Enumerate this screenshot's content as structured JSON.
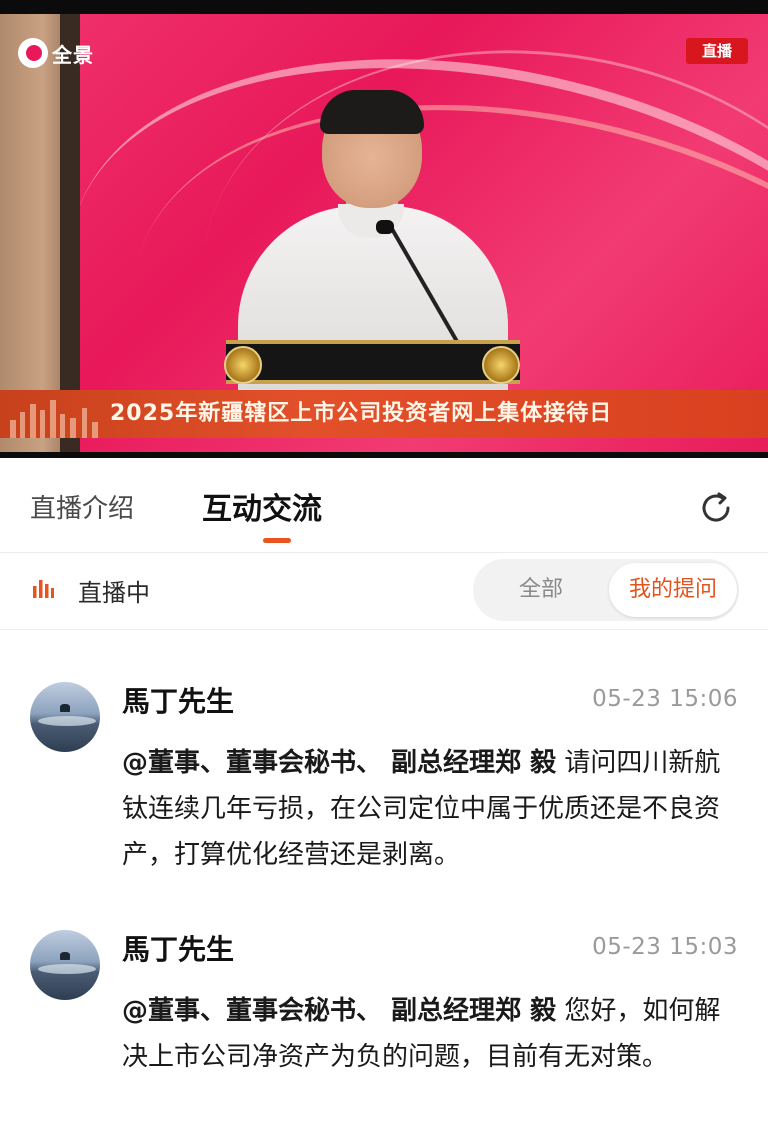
{
  "video": {
    "brand_name": "全景",
    "live_badge": "直播",
    "banner_title": "2025年新疆辖区上市公司投资者网上集体接待日"
  },
  "tabs": {
    "intro_label": "直播介绍",
    "interact_label": "互动交流",
    "active": "互动交流"
  },
  "status": {
    "live_text": "直播中",
    "filter_all": "全部",
    "filter_mine": "我的提问",
    "filter_selected": "我的提问"
  },
  "messages": [
    {
      "author": "馬丁先生",
      "time": "05-23 15:06",
      "mention": "@董事、董事会秘书、 副总经理郑 毅",
      "text": "请问四川新航钛连续几年亏损，在公司定位中属于优质还是不良资产，打算优化经营还是剥离。"
    },
    {
      "author": "馬丁先生",
      "time": "05-23 15:03",
      "mention": "@董事、董事会秘书、 副总经理郑 毅",
      "text": "您好，如何解决上市公司净资产为负的问题，目前有无对策。"
    }
  ],
  "colors": {
    "accent": "#e9541e",
    "live_badge": "#d8161e",
    "stage_background": "#e8185a"
  },
  "icons": {
    "refresh": "refresh-icon",
    "live_status": "bar-chart-icon"
  }
}
